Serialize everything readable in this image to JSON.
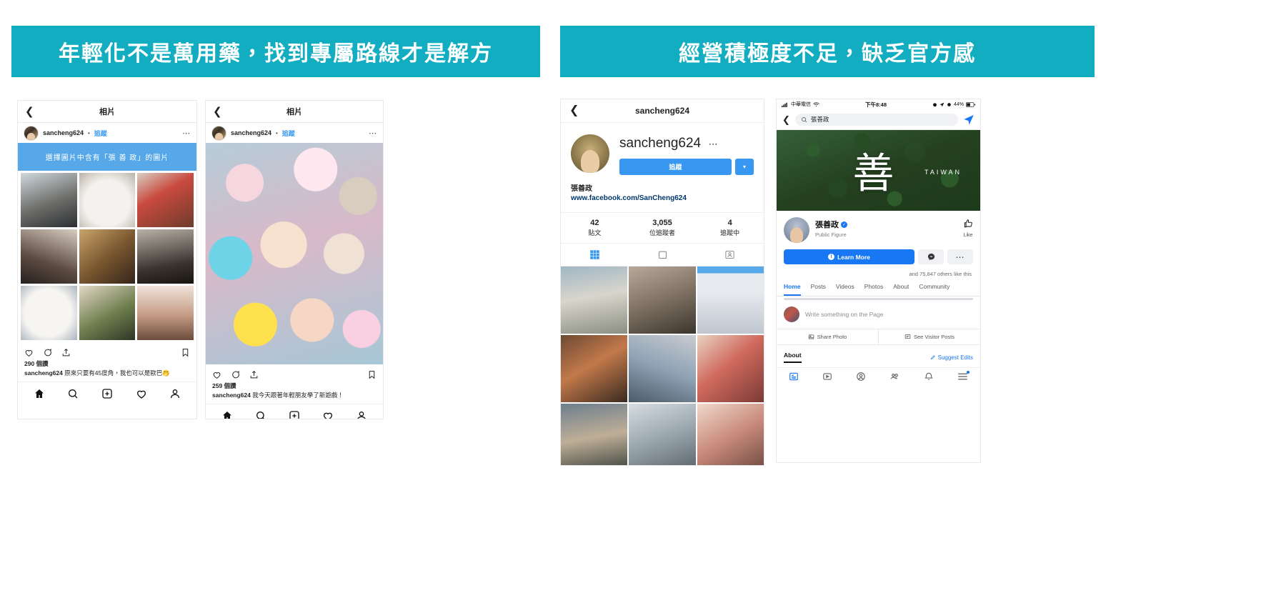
{
  "banners": {
    "left": "年輕化不是萬用藥，找到專屬路線才是解方",
    "right": "經營積極度不足，缺乏官方感",
    "color": "#12adc1"
  },
  "phone1": {
    "nav_title": "相片",
    "back_icon": "chevron-left-icon",
    "username": "sancheng624",
    "separator": "•",
    "follow_label": "追蹤",
    "more_icon": "ellipsis-icon",
    "overlay_banner": "選擇圖片中含有「張 善 政」的圖片",
    "grid_alt": [
      "man-in-suit",
      "white-cat",
      "santa-hat-man",
      "korean-actor-profile",
      "man-in-suit-smiling",
      "korean-actor-dark",
      "white-cat-closeup",
      "green-hair-actor",
      "korean-actor-side"
    ],
    "like_icon": "heart-icon",
    "comment_icon": "comment-icon",
    "share_icon": "share-icon",
    "save_icon": "bookmark-icon",
    "likes": "290 個讚",
    "caption_user": "sancheng624",
    "caption_text": "原來只要有45度角，我也可以是歐巴🤭",
    "tabbar": [
      "home-icon",
      "search-icon",
      "add-post-icon",
      "activity-icon",
      "profile-icon"
    ]
  },
  "phone2": {
    "nav_title": "相片",
    "back_icon": "chevron-left-icon",
    "username": "sancheng624",
    "separator": "•",
    "follow_label": "追蹤",
    "more_icon": "ellipsis-icon",
    "photo_alt": "zepeto-avatar-group-selfie",
    "like_icon": "heart-icon",
    "comment_icon": "comment-icon",
    "share_icon": "share-icon",
    "save_icon": "bookmark-icon",
    "likes": "259 個讚",
    "caption_user": "sancheng624",
    "caption_text": "我今天跟著年輕朋友學了新遊戲！",
    "tabbar": [
      "home-icon",
      "search-icon",
      "add-post-icon",
      "activity-icon",
      "profile-icon"
    ]
  },
  "phone3": {
    "nav_title": "sancheng624",
    "back_icon": "chevron-left-icon",
    "handle": "sancheng624",
    "handle_more": "⋯",
    "follow_label": "追蹤",
    "caret_label": "▾",
    "display_name": "張善政",
    "website": "www.facebook.com/SanCheng624",
    "stats": [
      {
        "value": "42",
        "label": "貼文"
      },
      {
        "value": "3,055",
        "label": "位追蹤者"
      },
      {
        "value": "4",
        "label": "追蹤中"
      }
    ],
    "tabs": [
      "grid-icon",
      "tv-icon",
      "tagged-icon"
    ],
    "tabbar": [
      "home-icon",
      "search-icon",
      "add-post-icon",
      "activity-icon",
      "profile-icon"
    ]
  },
  "phone4": {
    "status_carrier": "中華電信",
    "status_signal_icon": "signal-bars-icon",
    "status_wifi_icon": "wifi-icon",
    "status_time": "下午8:48",
    "status_battery": "44%",
    "status_battery_icon": "battery-icon",
    "status_alarm_icon": "alarm-icon",
    "status_location_icon": "location-arrow-icon",
    "back_icon": "chevron-left-icon",
    "search_icon": "search-icon",
    "search_value": "張善政",
    "messenger_icon": "messenger-send-icon",
    "cover_glyph": "善",
    "cover_subtitle": "TAIWAN",
    "page_name": "張善政",
    "verified_icon": "verified-badge-icon",
    "page_type": "Public Figure",
    "like_icon": "thumbs-up-icon",
    "like_label": "Like",
    "cta_label": "Learn More",
    "cta_info_icon": "info-icon",
    "messenger_btn_icon": "messenger-icon",
    "more_btn_icon": "ellipsis-icon",
    "others_like": "and 75,847 others like this",
    "tabs": [
      "Home",
      "Posts",
      "Videos",
      "Photos",
      "About",
      "Community"
    ],
    "active_tab": "Home",
    "composer_placeholder": "Write something on the Page",
    "actions": [
      {
        "icon": "photo-icon",
        "label": "Share Photo"
      },
      {
        "icon": "visitor-posts-icon",
        "label": "See Visitor Posts"
      }
    ],
    "about_label": "About",
    "suggest_label": "Suggest Edits",
    "suggest_icon": "pencil-icon",
    "bottomnav": [
      "news-feed-icon",
      "watch-icon",
      "profile-icon",
      "groups-icon",
      "notifications-icon",
      "menu-icon"
    ]
  }
}
